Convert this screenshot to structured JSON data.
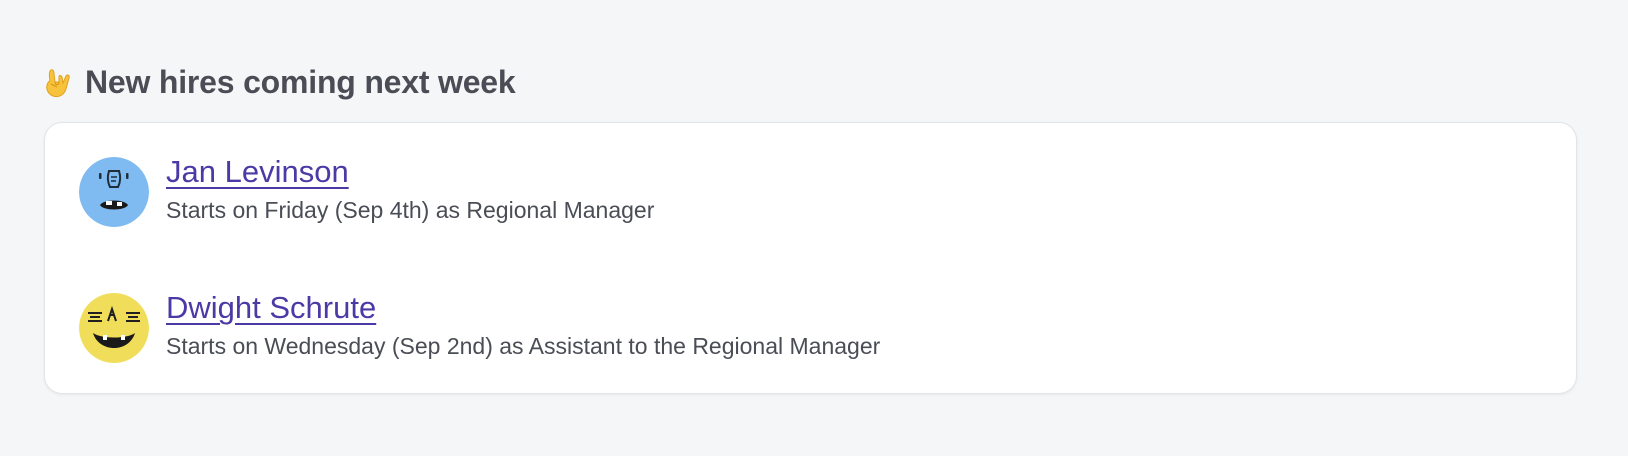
{
  "section": {
    "emoji_icon": "sign-of-the-horns-icon",
    "title": "New hires coming next week"
  },
  "hires": [
    {
      "name": "Jan Levinson",
      "description": "Starts on Friday (Sep 4th) as Regional Manager",
      "avatar_icon": "blue-monster-avatar-icon",
      "avatar_color": "#7fbbf0"
    },
    {
      "name": "Dwight Schrute",
      "description": "Starts on Wednesday (Sep 2nd) as Assistant to the Regional Manager",
      "avatar_icon": "yellow-monster-avatar-icon",
      "avatar_color": "#f0dd5a"
    }
  ],
  "colors": {
    "background": "#f5f6f8",
    "link": "#4b3aa6",
    "text": "#4a4d55"
  }
}
